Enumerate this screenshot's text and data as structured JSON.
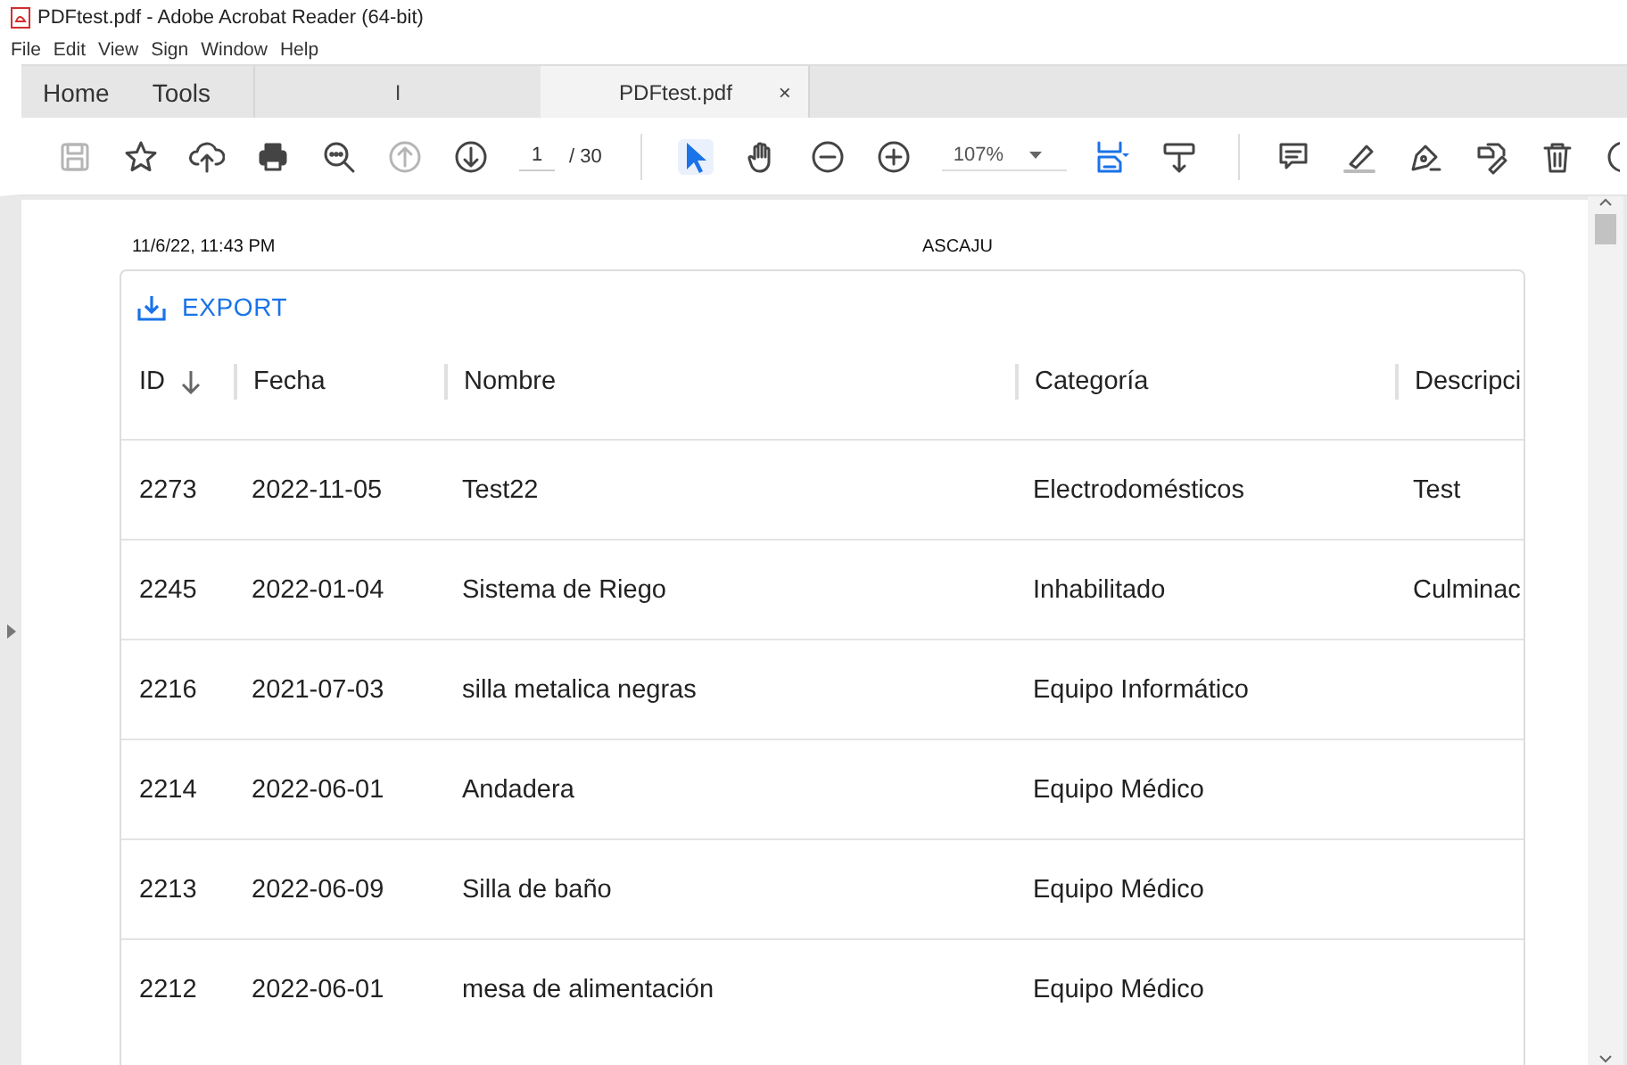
{
  "window": {
    "title": "PDFtest.pdf - Adobe Acrobat Reader (64-bit)"
  },
  "menu": [
    "File",
    "Edit",
    "View",
    "Sign",
    "Window",
    "Help"
  ],
  "tabs": [
    {
      "label": "Home",
      "selected": false
    },
    {
      "label": "Tools",
      "selected": false
    },
    {
      "label": "PDFtest.pdf",
      "selected": true,
      "close": "×"
    }
  ],
  "tab_strip_mark": "I",
  "toolbar": {
    "tools": [
      {
        "kind": "save",
        "disabled": true,
        "selected": false
      },
      {
        "kind": "star",
        "disabled": false,
        "selected": false
      },
      {
        "kind": "upload",
        "disabled": false,
        "selected": false
      },
      {
        "kind": "print",
        "disabled": false,
        "selected": false
      },
      {
        "kind": "find",
        "disabled": false,
        "selected": false
      },
      {
        "kind": "prev",
        "disabled": true,
        "selected": false
      },
      {
        "kind": "next",
        "disabled": false,
        "selected": false
      },
      {
        "kind": "page"
      },
      {
        "kind": "sep"
      },
      {
        "kind": "pointer",
        "disabled": false,
        "selected": true
      },
      {
        "kind": "hand",
        "disabled": false,
        "selected": false
      },
      {
        "kind": "zoomout",
        "disabled": false,
        "selected": false
      },
      {
        "kind": "zoomin",
        "disabled": false,
        "selected": false
      },
      {
        "kind": "zoom"
      },
      {
        "kind": "fit",
        "disabled": false,
        "selected": false
      },
      {
        "kind": "scroll",
        "disabled": false,
        "selected": false
      },
      {
        "kind": "sep"
      },
      {
        "kind": "comment",
        "disabled": false,
        "selected": false
      },
      {
        "kind": "highlight",
        "disabled": false,
        "selected": false
      },
      {
        "kind": "sign",
        "disabled": false,
        "selected": false
      },
      {
        "kind": "fill",
        "disabled": false,
        "selected": false
      },
      {
        "kind": "trash",
        "disabled": false,
        "selected": false
      },
      {
        "kind": "more",
        "disabled": false,
        "selected": false
      }
    ],
    "page_number": "1",
    "page_total": "/ 30",
    "zoom": "107%"
  },
  "document": {
    "printed_at": "11/6/22, 11:43 PM",
    "title": "ASCAJU",
    "export_label": "EXPORT",
    "table": {
      "columns": [
        "ID",
        "Fecha",
        "Nombre",
        "Categoría",
        "Descripci"
      ],
      "rows": [
        [
          "2273",
          "2022-11-05",
          "Test22",
          "Electrodomésticos",
          "Test"
        ],
        [
          "2245",
          "2022-01-04",
          "Sistema de Riego",
          "Inhabilitado",
          "Culminac"
        ],
        [
          "2216",
          "2021-07-03",
          "silla metalica negras",
          "Equipo Informático",
          ""
        ],
        [
          "2214",
          "2022-06-01",
          "Andadera",
          "Equipo Médico",
          ""
        ],
        [
          "2213",
          "2022-06-09",
          "Silla de baño",
          "Equipo Médico",
          ""
        ],
        [
          "2212",
          "2022-06-01",
          "mesa de alimentación",
          "Equipo Médico",
          ""
        ]
      ]
    }
  }
}
